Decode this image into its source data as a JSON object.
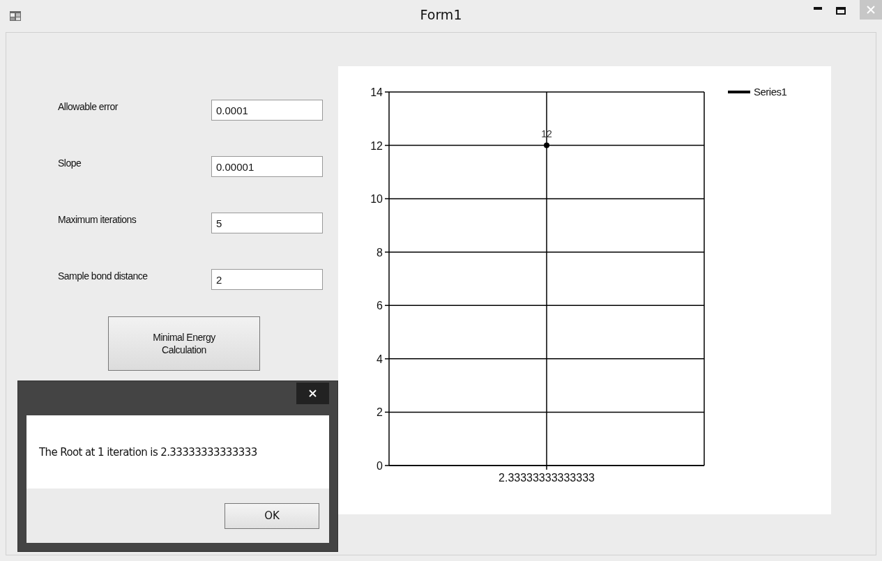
{
  "window": {
    "title": "Form1"
  },
  "fields": [
    {
      "label": "Allowable error",
      "value": "0.0001"
    },
    {
      "label": "Slope",
      "value": "0.00001"
    },
    {
      "label": "Maximum iterations",
      "value": "5"
    },
    {
      "label": "Sample bond distance",
      "value": "2"
    }
  ],
  "calculate_button": "Minimal Energy Calculation",
  "chart": {
    "chart_data": {
      "type": "line",
      "categories": [
        "2.33333333333333"
      ],
      "series": [
        {
          "name": "Series1",
          "color": "#000000",
          "marker": "circle",
          "values": [
            12
          ]
        }
      ],
      "ylim": [
        0,
        14
      ],
      "yticks": [
        0,
        2,
        4,
        6,
        8,
        10,
        12,
        14
      ],
      "data_labels": true
    }
  },
  "dialog": {
    "message": "The Root at 1 iteration is 2.33333333333333",
    "ok_button": "OK"
  }
}
